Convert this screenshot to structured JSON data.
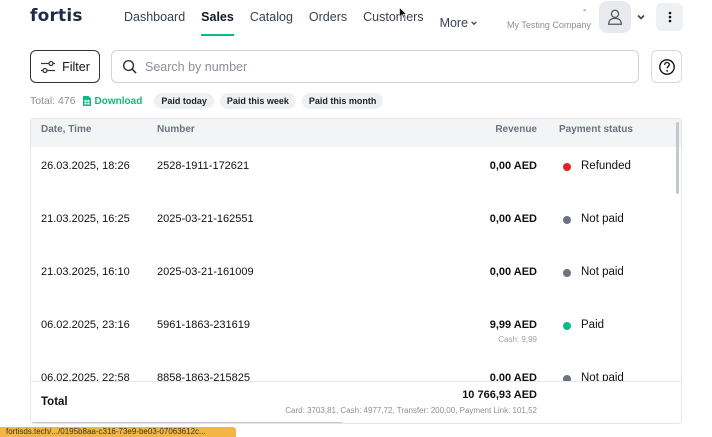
{
  "header": {
    "logo": "fortis",
    "nav": [
      {
        "label": "Dashboard",
        "active": false
      },
      {
        "label": "Sales",
        "active": true
      },
      {
        "label": "Catalog",
        "active": false
      },
      {
        "label": "Orders",
        "active": false
      },
      {
        "label": "Customers",
        "active": false
      }
    ],
    "more_label": "More",
    "company_dash": "-",
    "company": "My Testing Company",
    "avatar_icon": "user-icon",
    "menu_icon": "kebab-icon"
  },
  "toolbar": {
    "filter_label": "Filter",
    "search_placeholder": "Search by number",
    "help_icon": "question-circle-icon"
  },
  "summary": {
    "total": "Total: 476",
    "download_label": "Download",
    "chips": [
      "Paid today",
      "Paid this week",
      "Paid this month"
    ]
  },
  "table": {
    "columns": {
      "date": "Date, Time",
      "number": "Number",
      "revenue": "Revenue",
      "status": "Payment status"
    },
    "rows": [
      {
        "date": "26.03.2025, 18:26",
        "number": "2528-1911-172621",
        "revenue": "0,00 AED",
        "sub": "",
        "status": "Refunded",
        "status_color": "#dc2626"
      },
      {
        "date": "21.03.2025, 16:25",
        "number": "2025-03-21-162551",
        "revenue": "0,00 AED",
        "sub": "",
        "status": "Not paid",
        "status_color": "#6b7280"
      },
      {
        "date": "21.03.2025, 16:10",
        "number": "2025-03-21-161009",
        "revenue": "0,00 AED",
        "sub": "",
        "status": "Not paid",
        "status_color": "#6b7280"
      },
      {
        "date": "06.02.2025, 23:16",
        "number": "5961-1863-231619",
        "revenue": "9,99 AED",
        "sub": "Cash: 9,99",
        "status": "Paid",
        "status_color": "#10b981"
      },
      {
        "date": "06.02.2025, 22:58",
        "number": "8858-1863-215825",
        "revenue": "0,00 AED",
        "sub": "",
        "status": "Not paid",
        "status_color": "#6b7280"
      }
    ],
    "footer": {
      "label": "Total",
      "amount": "10 766,93 AED",
      "breakdown": "Card: 3703,81, Cash: 4977,72, Transfer: 200,00, Payment Link: 101,52"
    }
  },
  "status_url": "fortisds.tech/.../0195b8aa-c316-73e9-be03-07063612c...",
  "colors": {
    "accent": "#10b981",
    "refunded": "#dc2626",
    "not_paid": "#6b7280"
  }
}
